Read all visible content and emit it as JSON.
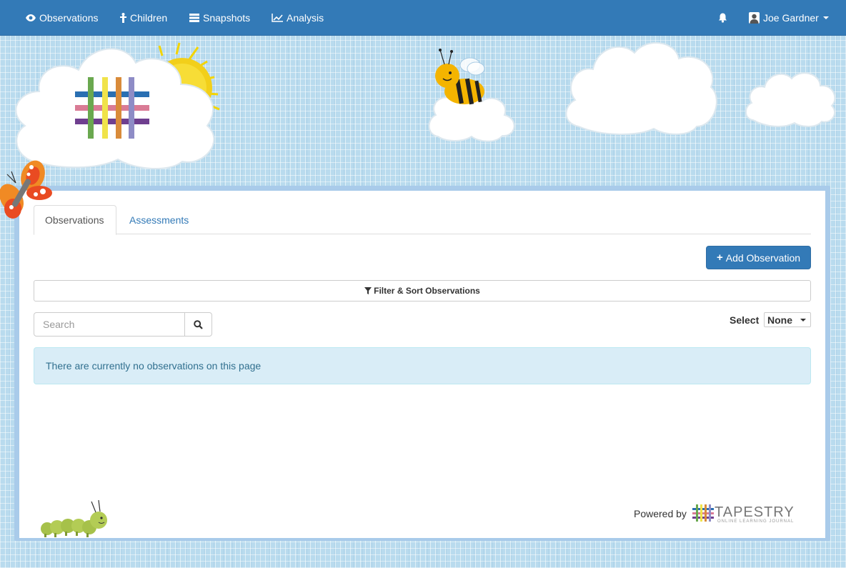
{
  "nav": {
    "items": [
      {
        "label": "Observations",
        "icon": "eye-icon"
      },
      {
        "label": "Children",
        "icon": "child-icon"
      },
      {
        "label": "Snapshots",
        "icon": "list-icon"
      },
      {
        "label": "Analysis",
        "icon": "line-chart-icon"
      }
    ],
    "notifications_icon": "bell-icon",
    "user": {
      "name": "Joe Gardner",
      "icon": "user-icon"
    }
  },
  "tabs": [
    {
      "label": "Observations",
      "active": true
    },
    {
      "label": "Assessments",
      "active": false
    }
  ],
  "actions": {
    "add_observation": "Add Observation"
  },
  "filter": {
    "label": "Filter & Sort Observations"
  },
  "search": {
    "placeholder": "Search",
    "value": ""
  },
  "select": {
    "label": "Select",
    "value": "None"
  },
  "alert": {
    "message": "There are currently no observations on this page"
  },
  "footer": {
    "powered_by": "Powered by",
    "brand": "TAPESTRY",
    "brand_sub": "ONLINE LEARNING JOURNAL"
  },
  "colors": {
    "navbar": "#337ab7",
    "accent": "#337ab7",
    "alert_bg": "#d9edf7",
    "alert_text": "#31708f",
    "background": "#b9dbee"
  }
}
